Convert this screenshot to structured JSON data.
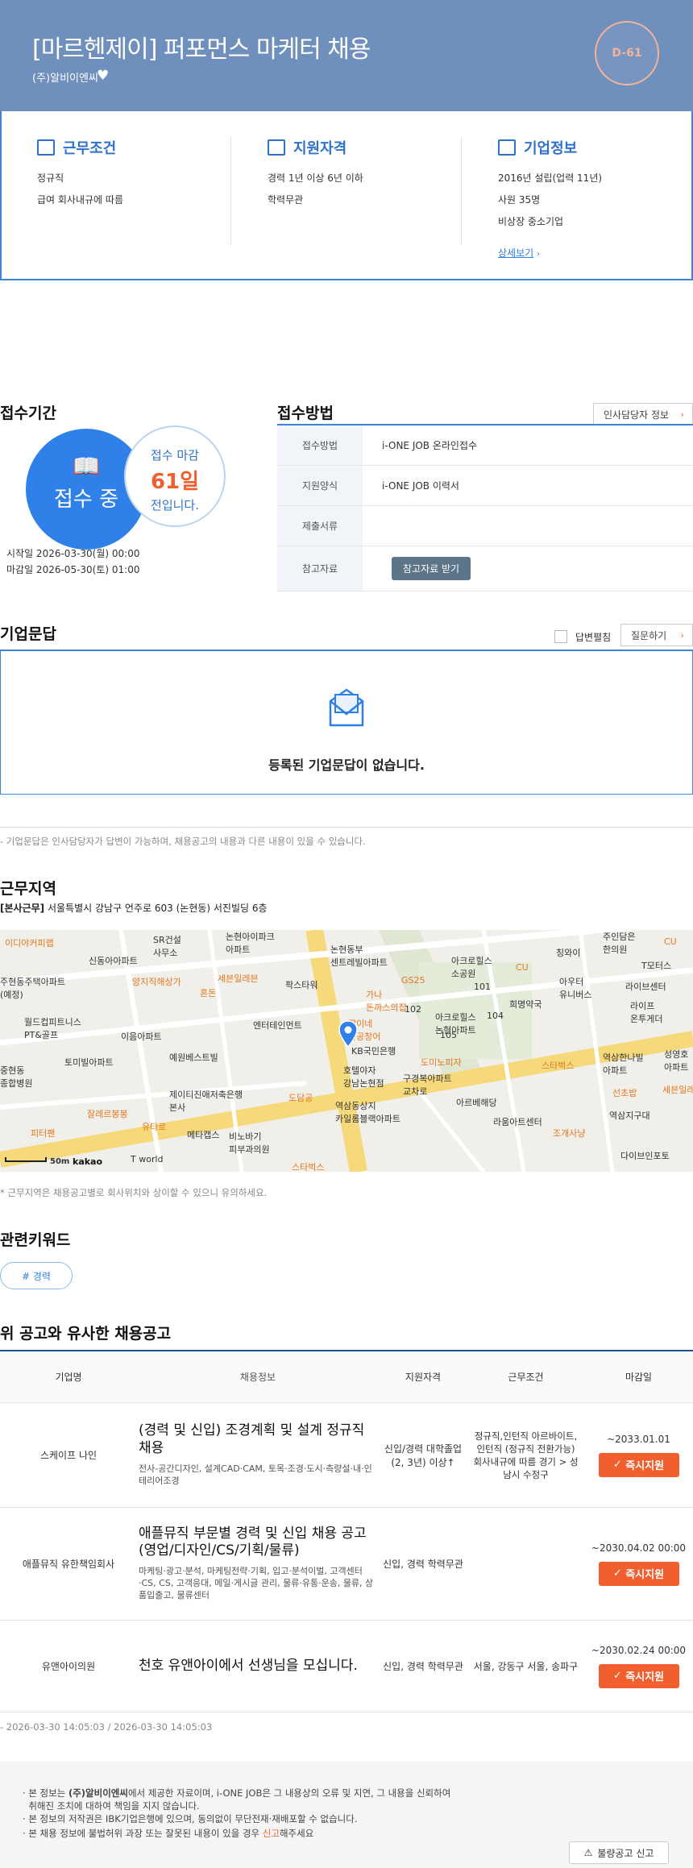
{
  "header": {
    "title": "[마르헨제이] 퍼포먼스 마케터 채용",
    "company": "(주)알비이엔씨",
    "dday": "D-61"
  },
  "summary": {
    "work": {
      "title": "근무조건",
      "lines": [
        "정규직",
        "급여 회사내규에 따름"
      ]
    },
    "qualify": {
      "title": "지원자격",
      "lines": [
        "경력 1년 이상 6년 이하",
        "학력무관"
      ]
    },
    "company": {
      "title": "기업정보",
      "lines": [
        "2016년 설립(업력 11년)",
        "사원 35명",
        "비상장 중소기업"
      ],
      "link": "상세보기"
    }
  },
  "reception": {
    "heading": "접수기간",
    "status": "접수 중",
    "deadline_label": "접수 마감",
    "deadline_days": "61일",
    "deadline_suffix": "전입니다.",
    "start": "시작일 2026-03-30(월) 00:00",
    "end": "마감일 2026-05-30(토) 01:00"
  },
  "apply_method": {
    "heading": "접수방법",
    "hr_button": "인사담당자 정보",
    "rows": [
      {
        "label": "접수방법",
        "value": "i-ONE JOB 온라인접수"
      },
      {
        "label": "지원양식",
        "value": "i-ONE JOB 이력서"
      },
      {
        "label": "제출서류",
        "value": ""
      },
      {
        "label": "참고자료",
        "button": "참고자료 받기"
      }
    ]
  },
  "qna": {
    "heading": "기업문답",
    "checkbox_label": "답변펼침",
    "ask_button": "질문하기",
    "empty_text": "등록된 기업문답이 없습니다.",
    "note": "- 기업문답은 인사담당자가 답변이 가능하며, 채용공고의 내용과 다른 내용이 있을 수 있습니다."
  },
  "location": {
    "heading": "근무지역",
    "label": "[본사근무]",
    "address": "서울특별시 강남구 언주로 603 (논현동) 서진빌딩 6층",
    "note": "* 근무지역은 채용공고별로 회사위치와 상이할 수 있으니 유의하세요.",
    "scale": "50m",
    "brand": "kakao",
    "map_labels": [
      "이디야커피랩",
      "신동아아파트",
      "SR건설 사무소",
      "논현아이파크 아파트",
      "세븐일레븐",
      "논현동부 센트레빌아파트",
      "GS25",
      "아크로힐스 소공원",
      "가나 돈까스의집",
      "짬이네 논공창어",
      "KB국민은행",
      "호텔야자 강남논현점",
      "아크로힐스 논현아파트",
      "도미노피자",
      "구경복아파트 교차로",
      "스타벅스",
      "희명약국",
      "주현동주택아파트 (예정)",
      "양지직해상가",
      "혼돈",
      "팍스타워",
      "엔터테인먼트",
      "월드컵피트니스 PT&골프",
      "이음아파트",
      "토미빌아파트",
      "예원베스트빌",
      "제이티진애저축은행 본사",
      "도담공",
      "역삼동상지 카일롬블랙아파트",
      "아르베해당",
      "라움아트센터",
      "역삼지구대",
      "조개사냥",
      "잘레르봉봉",
      "유타로",
      "메타캡스",
      "비노바기 피부과의원",
      "피터팬",
      "T world",
      "다이브인포토",
      "역삼정기아",
      "선초밥",
      "세븐일레븐",
      "역삼한나빌 아파트",
      "성영호 아파트",
      "라이프 온투게더",
      "아우터 유니버스",
      "라이브센터",
      "T모터스",
      "칭와이",
      "주인담은 한의원",
      "CU",
      "CU",
      "102",
      "101",
      "104",
      "105"
    ]
  },
  "keywords": {
    "heading": "관련키워드",
    "items": [
      "# 경력"
    ]
  },
  "similar": {
    "heading": "위 공고와 유사한 채용공고",
    "columns": [
      "기업명",
      "채용정보",
      "지원자격",
      "근무조건",
      "마감일"
    ],
    "rows": [
      {
        "company": "스케이프 나인",
        "title": "(경력 및 신입) 조경계획 및 설계 정규직 채용",
        "tags": "전사-공간디자인, 설계CAD·CAM, 토목·조경·도시·측량설·내·인테리어조경",
        "qualify": "신입/경력 대학졸업(2, 3년) 이상↑",
        "condition": "정규직,인턴직 아르바이트,인턴직 (정규직 전환가능) 회사내규에 따름 경기 > 성남시 수정구",
        "deadline": "~2033.01.01",
        "button": "즉시지원"
      },
      {
        "company": "애플뮤직 유한책임회사",
        "title": "애플뮤직 부문별 경력 및 신입 채용 공고 (영업/디자인/CS/기획/물류)",
        "tags": "마케팅·광고·분석, 마케팅전략·기획, 입고·분석이벌, 고객센터·CS, CS, 고객응대, 메일·게시글 관리, 물류·유통·운송, 물류, 상품입출고, 물류센터",
        "qualify": "신입, 경력 학력무관",
        "condition": "",
        "deadline": "~2030.04.02 00:00",
        "button": "즉시지원"
      },
      {
        "company": "유앤아이의원",
        "title": "천호 유앤아이에서 선생님을 모십니다.",
        "tags": "",
        "qualify": "신입, 경력 학력무관",
        "condition": "서울, 강동구 서울, 송파구",
        "deadline": "~2030.02.24 00:00",
        "button": "즉시지원"
      }
    ],
    "timestamp": "- 2026-03-30 14:05:03 / 2026-03-30 14:05:03"
  },
  "notice": {
    "line1a": "본 정보는",
    "line1b": "(주)알비이엔씨",
    "line1c": "에서 제공한 자료이며, i-ONE JOB은 그 내용상의 오류 및 지연, 그 내용을 신뢰하여",
    "line1d": "취해진 조치에 대하여 책임을 지지 않습니다.",
    "line2": "본 정보의 저작권은 IBK기업은행에 있으며, 동의없이 무단전재·재배포할 수 없습니다.",
    "line3a": "본 채용 정보에 불법허위 과장 또는 잘못된 내용이 있을 경우",
    "line3b": "신고",
    "line3c": "해주세요",
    "report_button": "불량공고 신고"
  }
}
